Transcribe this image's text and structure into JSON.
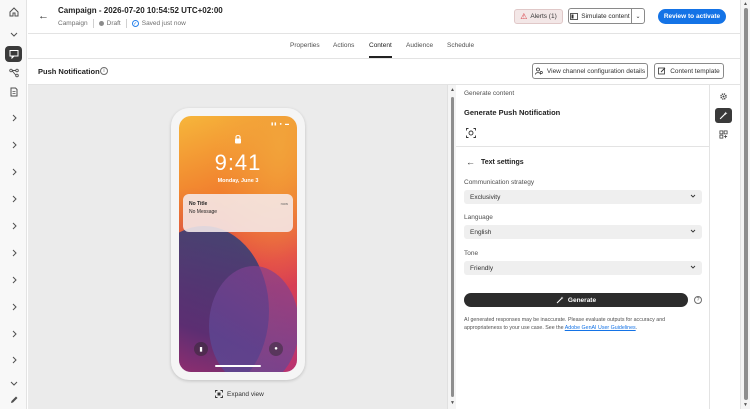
{
  "header": {
    "title": "Campaign - 2026-07-20 10:54:52 UTC+02:00",
    "breadcrumb": "Campaign",
    "status": "Draft",
    "saved": "Saved just now",
    "alerts_label": "Alerts (1)",
    "simulate_label": "Simulate content",
    "review_label": "Review to activate"
  },
  "tabs": [
    "Properties",
    "Actions",
    "Content",
    "Audience",
    "Schedule"
  ],
  "active_tab": "Content",
  "toolbar": {
    "title": "Push Notification",
    "channel_config_label": "View channel configuration details",
    "content_template_label": "Content template"
  },
  "preview": {
    "time": "9:41",
    "date": "Monday, June 3",
    "notification": {
      "title": "No Title",
      "message": "No Message",
      "time": "now"
    },
    "expand_label": "Expand view"
  },
  "panel": {
    "subtitle": "Generate content",
    "title": "Generate Push Notification",
    "section_title": "Text settings",
    "fields": [
      {
        "label": "Communication strategy",
        "value": "Exclusivity"
      },
      {
        "label": "Language",
        "value": "English"
      },
      {
        "label": "Tone",
        "value": "Friendly"
      }
    ],
    "generate_label": "Generate",
    "disclaimer_text": "AI generated responses may be inaccurate. Please evaluate outputs for accuracy and appropriateness to your use case. See the ",
    "disclaimer_link": "Adobe GenAI User Guidelines",
    "disclaimer_end": "."
  },
  "colors": {
    "accent": "#1473e6",
    "dark": "#2c2c2c",
    "alert": "#d7373f"
  }
}
